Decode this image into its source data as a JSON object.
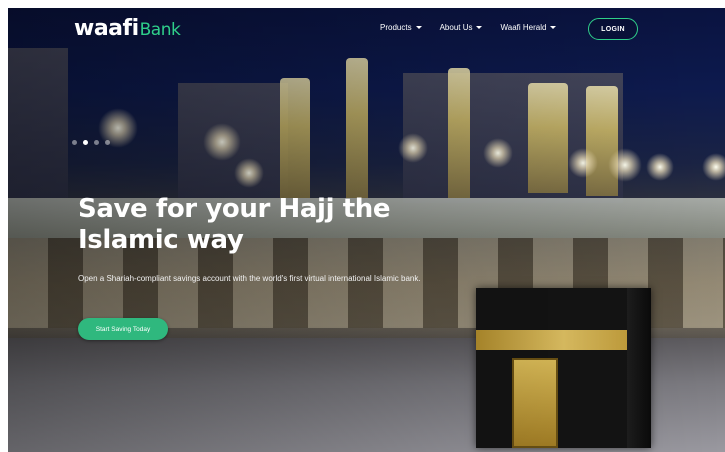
{
  "header": {
    "logo_main": "waafi",
    "logo_suffix": "Bank",
    "menu": [
      {
        "label": "Products"
      },
      {
        "label": "About Us"
      },
      {
        "label": "Waafi Herald"
      }
    ],
    "login_label": "LOGIN"
  },
  "hero": {
    "title": "Save for your Hajj the Islamic way",
    "subtitle": "Open a Shariah-compliant savings account with the world's first virtual international Islamic bank.",
    "cta_label": "Start Saving Today",
    "slides_total": 4,
    "slide_active": 2
  },
  "colors": {
    "accent": "#2fcf8a",
    "cta": "#2fb87e",
    "text": "#ffffff"
  },
  "icons": [
    "chevron-down-icon"
  ]
}
